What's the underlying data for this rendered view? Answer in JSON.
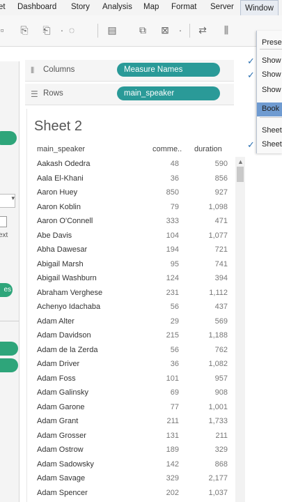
{
  "menu": {
    "items": [
      "et",
      "Dashboard",
      "Story",
      "Analysis",
      "Map",
      "Format",
      "Server",
      "Window"
    ]
  },
  "window_menu": {
    "items": [
      {
        "label": "Prese",
        "checked": false,
        "highlight": false
      },
      {
        "label": "Show",
        "checked": true,
        "highlight": false
      },
      {
        "label": "Show",
        "checked": true,
        "highlight": false
      },
      {
        "label": "Show",
        "checked": false,
        "highlight": false
      },
      {
        "label": "Book",
        "checked": false,
        "highlight": true
      },
      {
        "label": "Sheet",
        "checked": false,
        "highlight": false
      },
      {
        "label": "Sheet",
        "checked": true,
        "highlight": false
      }
    ]
  },
  "shelves": {
    "columns_label": "Columns",
    "columns_pill": "Measure Names",
    "rows_label": "Rows",
    "rows_pill": "main_speaker"
  },
  "left_panel": {
    "text_fragment": "ext",
    "pill_fragment": "es"
  },
  "sheet": {
    "title": "Sheet 2",
    "headers": [
      "main_speaker",
      "comme..",
      "duration"
    ],
    "rows": [
      [
        "Aakash Odedra",
        "48",
        "590"
      ],
      [
        "Aala El-Khani",
        "36",
        "856"
      ],
      [
        "Aaron Huey",
        "850",
        "927"
      ],
      [
        "Aaron Koblin",
        "79",
        "1,098"
      ],
      [
        "Aaron O'Connell",
        "333",
        "471"
      ],
      [
        "Abe Davis",
        "104",
        "1,077"
      ],
      [
        "Abha Dawesar",
        "194",
        "721"
      ],
      [
        "Abigail Marsh",
        "95",
        "741"
      ],
      [
        "Abigail Washburn",
        "124",
        "394"
      ],
      [
        "Abraham Verghese",
        "231",
        "1,112"
      ],
      [
        "Achenyo Idachaba",
        "56",
        "437"
      ],
      [
        "Adam Alter",
        "29",
        "569"
      ],
      [
        "Adam Davidson",
        "215",
        "1,188"
      ],
      [
        "Adam de la Zerda",
        "56",
        "762"
      ],
      [
        "Adam Driver",
        "36",
        "1,082"
      ],
      [
        "Adam Foss",
        "101",
        "957"
      ],
      [
        "Adam Galinsky",
        "69",
        "908"
      ],
      [
        "Adam Garone",
        "77",
        "1,001"
      ],
      [
        "Adam Grant",
        "211",
        "1,733"
      ],
      [
        "Adam Grosser",
        "131",
        "211"
      ],
      [
        "Adam Ostrow",
        "189",
        "329"
      ],
      [
        "Adam Sadowsky",
        "142",
        "868"
      ],
      [
        "Adam Savage",
        "329",
        "2,177"
      ],
      [
        "Adam Spencer",
        "202",
        "1,037"
      ]
    ]
  },
  "colors": {
    "pill_teal": "#2a9a98",
    "pill_green": "#2ea57a",
    "menu_highlight": "#6f9bd1"
  }
}
